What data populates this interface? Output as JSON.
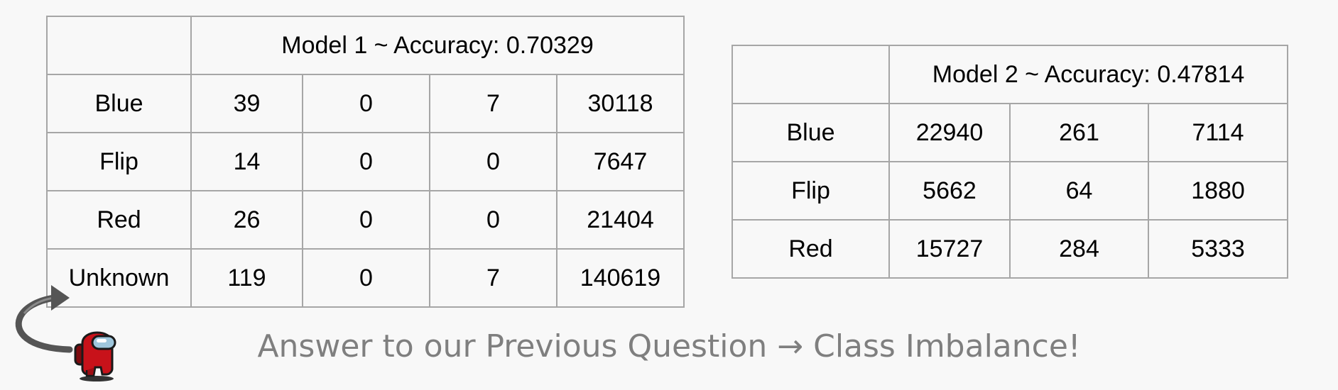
{
  "table1": {
    "title": "Model 1 ~ Accuracy: 0.70329",
    "rows": [
      {
        "label": "Blue",
        "values": [
          "39",
          "0",
          "7",
          "30118"
        ]
      },
      {
        "label": "Flip",
        "values": [
          "14",
          "0",
          "0",
          "7647"
        ]
      },
      {
        "label": "Red",
        "values": [
          "26",
          "0",
          "0",
          "21404"
        ]
      },
      {
        "label": "Unknown",
        "values": [
          "119",
          "0",
          "7",
          "140619"
        ]
      }
    ]
  },
  "table2": {
    "title": "Model 2 ~ Accuracy: 0.47814",
    "rows": [
      {
        "label": "Blue",
        "values": [
          "22940",
          "261",
          "7114"
        ]
      },
      {
        "label": "Flip",
        "values": [
          "5662",
          "64",
          "1880"
        ]
      },
      {
        "label": "Red",
        "values": [
          "15727",
          "284",
          "5333"
        ]
      }
    ]
  },
  "caption": "Answer to our Previous Question → Class Imbalance!",
  "icons": [
    "curved-arrow-icon",
    "crewmate-icon"
  ],
  "colors": {
    "grid": "#a6a6a6",
    "caption": "#7f7f7f",
    "crewmate_red": "#c8121a",
    "visor": "#9fc7dd"
  }
}
